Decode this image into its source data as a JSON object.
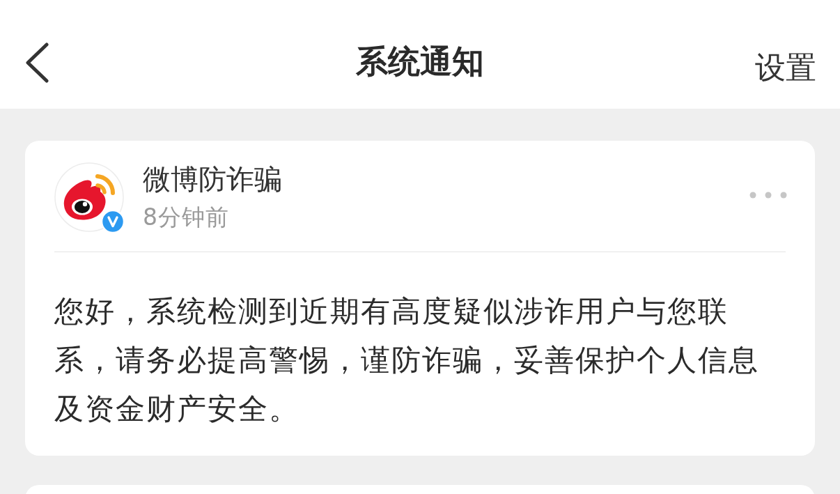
{
  "header": {
    "title": "系统通知",
    "settings_label": "设置"
  },
  "notifications": [
    {
      "sender": "微博防诈骗",
      "verified": true,
      "time": "8分钟前",
      "message": "您好，系统检测到近期有高度疑似涉诈用户与您联系，请务必提高警惕，谨防诈骗，妥善保护个人信息及资金财产安全。"
    }
  ]
}
